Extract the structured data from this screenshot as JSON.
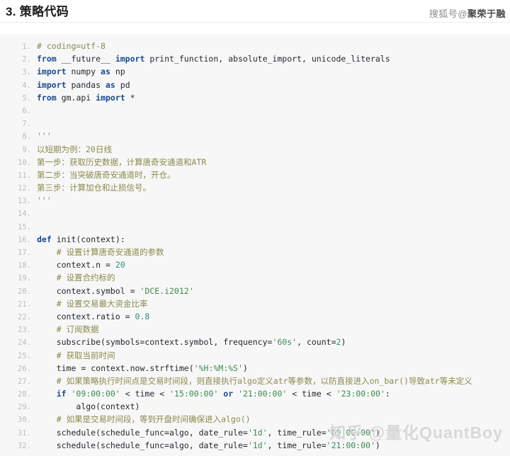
{
  "header": {
    "title": "3. 策略代码",
    "watermark_prefix": "搜狐号",
    "watermark_at": "@",
    "watermark_name": "聚荣于融"
  },
  "footer": {
    "watermark": "知乎 @量化QuantBoy"
  },
  "code": {
    "language": "python",
    "line_numbers": [
      "1.",
      "2.",
      "3.",
      "4.",
      "5.",
      "6.",
      "7.",
      "8.",
      "9.",
      "10.",
      "11.",
      "12.",
      "13.",
      "14.",
      "15.",
      "16.",
      "17.",
      "18.",
      "19.",
      "20.",
      "21.",
      "22.",
      "23.",
      "24.",
      "25.",
      "26.",
      "27.",
      "28.",
      "29.",
      "30.",
      "31.",
      "32."
    ],
    "lines": [
      "# coding=utf-8",
      "from __future__ import print_function, absolute_import, unicode_literals",
      "import numpy as np",
      "import pandas as pd",
      "from gm.api import *",
      "",
      "",
      "'''",
      "以短期为例：20日线",
      "第一步：获取历史数据，计算唐奇安通道和ATR",
      "第二步：当突破唐奇安通道时，开仓。",
      "第三步：计算加仓和止损信号。",
      "'''",
      "",
      "",
      "def init(context):",
      "    # 设置计算唐奇安通道的参数",
      "    context.n = 20",
      "    # 设置合约标的",
      "    context.symbol = 'DCE.i2012'",
      "    # 设置交易最大资金比率",
      "    context.ratio = 0.8",
      "    # 订阅数据",
      "    subscribe(symbols=context.symbol, frequency='60s', count=2)",
      "    # 获取当前时间",
      "    time = context.now.strftime('%H:%M:%S')",
      "    # 如果策略执行时间点是交易时间段，则直接执行algo定义atr等参数，以防直接进入on_bar()导致atr等未定义",
      "    if '09:00:00' < time < '15:00:00' or '21:00:00' < time < '23:00:00':",
      "        algo(context)",
      "    # 如果是交易时间段，等到开盘时间确保进入algo()",
      "    schedule(schedule_func=algo, date_rule='1d', time_rule='09:00:00')",
      "    schedule(schedule_func=algo, date_rule='1d', time_rule='21:00:00')"
    ]
  },
  "colors": {
    "background": "#ffffff",
    "code_background": "#f7f7f8",
    "comment": "#8a8a4d",
    "keyword": "#1a4b8c",
    "string": "#3f8a4f",
    "number": "#2f8f7a",
    "text": "#24292e",
    "line_number": "#bdbdbd",
    "watermark": "#d8d8d8"
  }
}
